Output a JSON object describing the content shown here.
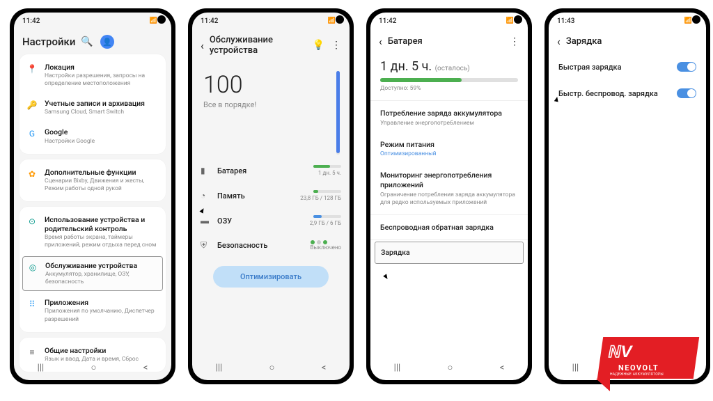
{
  "status_time": [
    "11:42",
    "11:42",
    "11:42",
    "11:43"
  ],
  "screen1": {
    "title": "Настройки",
    "groups": [
      [
        {
          "icon": "📍",
          "cls": "green",
          "label": "Локация",
          "sub": "Настройки разрешения, запросы на определение местоположения"
        },
        {
          "icon": "🔑",
          "cls": "orange",
          "label": "Учетные записи и архивация",
          "sub": "Samsung Cloud, Smart Switch"
        },
        {
          "icon": "G",
          "cls": "blue",
          "label": "Google",
          "sub": "Настройки Google"
        }
      ],
      [
        {
          "icon": "✿",
          "cls": "orange",
          "label": "Дополнительные функции",
          "sub": "Сценарии Bixby, Движения и жесты, Режим работы одной рукой"
        }
      ],
      [
        {
          "icon": "⊙",
          "cls": "teal",
          "label": "Использование устройства и родительский контроль",
          "sub": "Время работы экрана, таймеры приложений, режим отдыха перед сном"
        },
        {
          "icon": "◎",
          "cls": "teal",
          "label": "Обслуживание устройства",
          "sub": "Аккумулятор, хранилище, ОЗУ, безопасность",
          "hi": true
        },
        {
          "icon": "⠿",
          "cls": "blue",
          "label": "Приложения",
          "sub": "Приложения по умолчанию, Диспетчер разрешений"
        }
      ],
      [
        {
          "icon": "≡",
          "cls": "gray",
          "label": "Общие настройки",
          "sub": "Язык и ввод, Дата и время, Сброс"
        }
      ]
    ]
  },
  "screen2": {
    "title": "Обслуживание устройства",
    "score": "100",
    "status": "Все в порядке!",
    "rows": [
      {
        "icon": "▮",
        "label": "Батарея",
        "bar": "b59",
        "val": "1 дн. 5 ч.",
        "hi": true
      },
      {
        "icon": "◔",
        "label": "Память",
        "bar": "b18",
        "val": "23,8 ГБ / 128 ГБ"
      },
      {
        "icon": "▬",
        "label": "ОЗУ",
        "bar": "b30",
        "val": "2,9 ГБ / 6 ГБ"
      },
      {
        "icon": "⛨",
        "label": "Безопасность",
        "toggles": true,
        "val": "Выключено"
      }
    ],
    "button": "Оптимизировать"
  },
  "screen3": {
    "title": "Батарея",
    "time": "1 дн. 5 ч.",
    "remaining": "(осталось)",
    "pct": "Доступно: 59%",
    "items": [
      {
        "label": "Потребление заряда аккумулятора",
        "sub": "Управление энергопотреблением"
      },
      {
        "label": "Режим питания",
        "sub": "Оптимизированный",
        "subcls": "blue"
      },
      {
        "label": "Мониторинг энергопотребления приложений",
        "sub": "Ограничение потребления заряда аккумулятора для редко используемых приложений"
      },
      {
        "label": "Беспроводная обратная зарядка"
      },
      {
        "label": "Зарядка",
        "hi": true
      }
    ]
  },
  "screen4": {
    "title": "Зарядка",
    "items": [
      {
        "label": "Быстрая зарядка"
      },
      {
        "label": "Быстр. беспровод. зарядка"
      }
    ]
  },
  "nav": [
    "|||",
    "○",
    "<"
  ],
  "logo": {
    "brand": "NEOVOLT",
    "tag": "НАДЕЖНЫЕ АККУМУЛЯТОРЫ"
  }
}
